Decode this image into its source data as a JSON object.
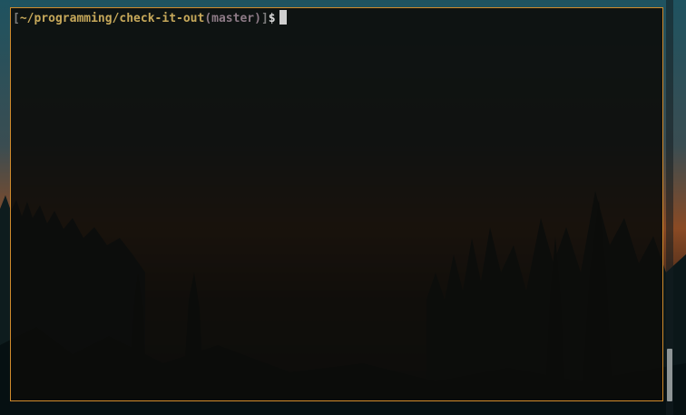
{
  "terminal": {
    "prompt": {
      "open_bracket": "[",
      "path": "~/programming/check-it-out",
      "branch_open": "(",
      "branch": "master",
      "branch_close": ")",
      "close_bracket": "]",
      "symbol": "$"
    }
  },
  "scrollbar": {
    "position_fraction": 0.86
  },
  "colors": {
    "window_border": "#d08a2c",
    "path_text": "#c6a85a",
    "branch_text": "#8d7a86",
    "bracket_text": "#7c7c7c",
    "cursor": "#cfcfcf"
  }
}
